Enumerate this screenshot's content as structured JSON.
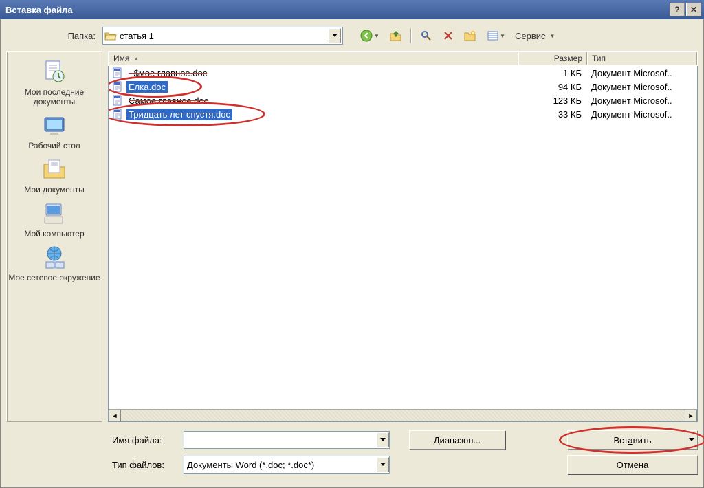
{
  "title": "Вставка файла",
  "folder_label": "Папка:",
  "current_folder": "статья 1",
  "tools_label": "Сервис",
  "headers": {
    "name": "Имя",
    "size": "Размер",
    "type": "Тип"
  },
  "places": [
    {
      "label": "Мои последние документы"
    },
    {
      "label": "Рабочий стол"
    },
    {
      "label": "Мои документы"
    },
    {
      "label": "Мой компьютер"
    },
    {
      "label": "Мое сетевое окружение"
    }
  ],
  "files": [
    {
      "name": "~$мое главное.doc",
      "size": "1 КБ",
      "type": "Документ Microsof..",
      "selected": false,
      "struck": true
    },
    {
      "name": "Елка.doc",
      "size": "94 КБ",
      "type": "Документ Microsof..",
      "selected": true,
      "struck": false
    },
    {
      "name": "Самое главное.doc",
      "size": "123 КБ",
      "type": "Документ Microsof..",
      "selected": false,
      "struck": true
    },
    {
      "name": "Тридцать лет спустя.doc",
      "size": "33 КБ",
      "type": "Документ Microsof..",
      "selected": true,
      "struck": false
    }
  ],
  "filename_label": "Имя файла:",
  "filetype_label": "Тип файлов:",
  "filetype_value": "Документы Word (*.doc; *.doc*)",
  "range_btn": "Диапазон...",
  "insert_btn": "Вставить",
  "cancel_btn": "Отмена"
}
